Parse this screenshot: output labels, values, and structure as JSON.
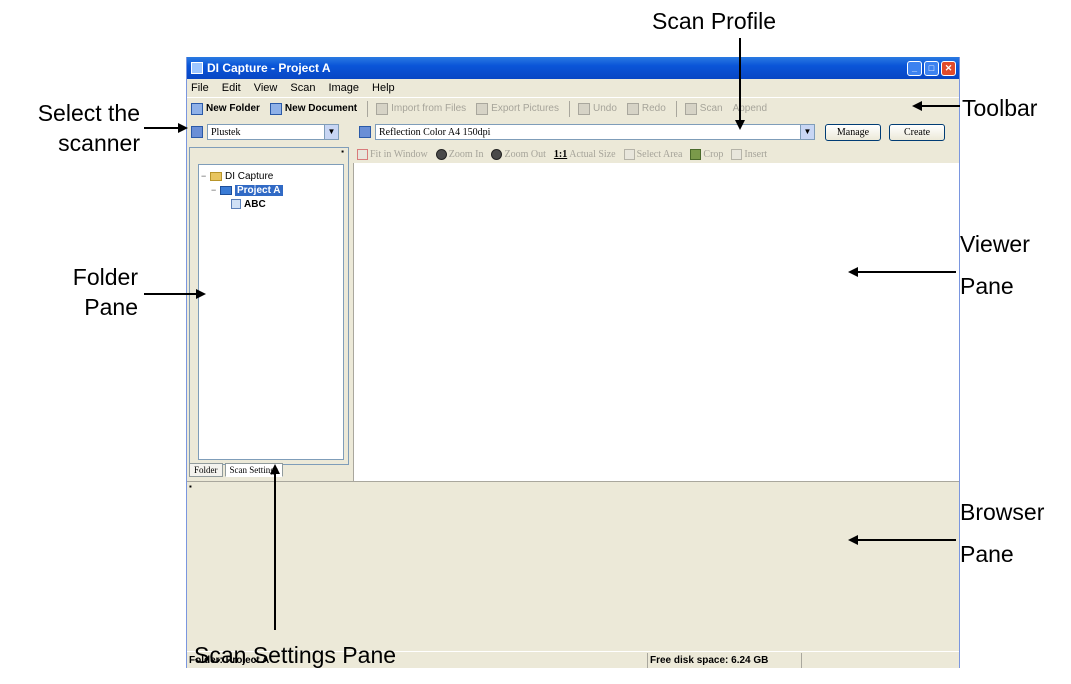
{
  "window": {
    "title": "DI Capture - Project A"
  },
  "menu": [
    "File",
    "Edit",
    "View",
    "Scan",
    "Image",
    "Help"
  ],
  "toolbar": {
    "new_folder": "New Folder",
    "new_document": "New Document",
    "import_from_files": "Import from Files",
    "export_pictures": "Export Pictures",
    "undo": "Undo",
    "redo": "Redo",
    "scan": "Scan",
    "append": "Append"
  },
  "scanner_select": {
    "value": "Plustek"
  },
  "profile_select": {
    "value": "Reflection Color A4 150dpi",
    "manage_label": "Manage",
    "create_label": "Create"
  },
  "viewer_toolbar": {
    "fit_in_window": "Fit in Window",
    "zoom_in": "Zoom In",
    "zoom_out": "Zoom Out",
    "actual_size_prefix": "1:1",
    "actual_size": "Actual Size",
    "select_area": "Select Area",
    "crop": "Crop",
    "insert": "Insert"
  },
  "tree": {
    "root": "DI Capture",
    "project": "Project A",
    "document": "ABC"
  },
  "pane_tabs": {
    "folder": "Folder",
    "scan_settings": "Scan Settings"
  },
  "status": {
    "folder": "Folder: Project A",
    "disk_space": "Free disk space: 6.24 GB"
  },
  "callouts": {
    "scan_profile": "Scan Profile",
    "toolbar": "Toolbar",
    "select_scanner_line1": "Select the",
    "select_scanner_line2": "scanner",
    "viewer_line1": "Viewer",
    "viewer_line2": "Pane",
    "folder_line1": "Folder",
    "folder_line2": "Pane",
    "browser_line1": "Browser",
    "browser_line2": "Pane",
    "scan_settings": "Scan Settings Pane"
  }
}
